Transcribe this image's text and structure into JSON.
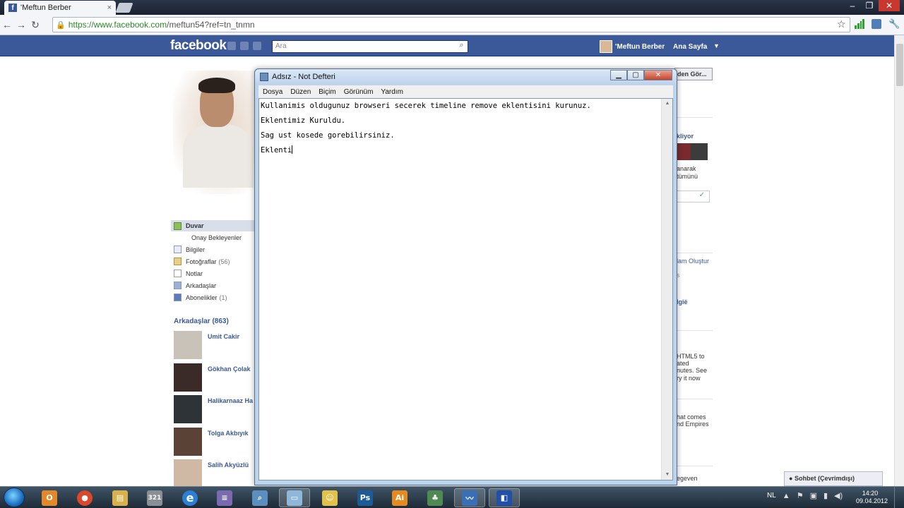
{
  "browser": {
    "tab_title": "'Meftun Berber",
    "tab_close": "×",
    "url_host": "https://www.facebook.com",
    "url_path": "/meftun54?ref=tn_tnmn",
    "back": "←",
    "forward": "→",
    "reload": "↻",
    "star": "☆",
    "wrench": "🔧",
    "window_min": "–",
    "window_max": "❐",
    "window_close": "✕"
  },
  "facebook": {
    "logo": "facebook",
    "search_placeholder": "Ara",
    "search_icon": "⌕",
    "user_name": "'Meftun Berber",
    "home": "Ana Sayfa",
    "caret": "▼",
    "nav": [
      {
        "label": "Duvar",
        "icon": "wall-icon"
      },
      {
        "label": "Onay Bekleyenler"
      },
      {
        "label": "Bilgiler",
        "icon": "info-icon"
      },
      {
        "label": "Fotoğraflar",
        "count": "(56)",
        "icon": "photos-icon"
      },
      {
        "label": "Notlar",
        "icon": "notes-icon"
      },
      {
        "label": "Arkadaşlar",
        "icon": "friends-icon"
      },
      {
        "label": "Abonelikler",
        "count": "(1)",
        "icon": "subscriptions-icon"
      }
    ],
    "friends_header": "Arkadaşlar (863)",
    "friends": [
      {
        "name": "Umit Cakir",
        "color": "#c9c2b8"
      },
      {
        "name": "Gökhan Çolak",
        "color": "#3a2a28"
      },
      {
        "name": "Halikarnaaz Ha",
        "color": "#2e3338"
      },
      {
        "name": "Tolga Akbıyık",
        "color": "#5a4336"
      },
      {
        "name": "Salih Akyüzlü",
        "color": "#cfb9a4"
      }
    ],
    "right_column": {
      "button": "den Gör...",
      "pending": "kliyor",
      "text1": "anarak",
      "text2": "tümünü",
      "check": "✓",
      "create": "lam Oluştur",
      "text3": "s",
      "link2": "lgië",
      "ad1": [
        "HTML5 to",
        "ated",
        "nutes. See",
        "ry it now"
      ],
      "ad2": [
        "hat comes",
        "nd Empires"
      ],
      "ad3": "egeven"
    },
    "chat": "Sohbet (Çevrimdışı)"
  },
  "notepad": {
    "title": "Adsız - Not Defteri",
    "btn_min": "▁",
    "btn_max": "▢",
    "btn_close": "✕",
    "menu": [
      "Dosya",
      "Düzen",
      "Biçim",
      "Görünüm",
      "Yardım"
    ],
    "lines": [
      "Kullanimis oldugunuz browseri secerek timeline remove eklentisini kurunuz.",
      "Eklentimiz Kuruldu.",
      "Sag ust kosede gorebilirsiniz.",
      "Eklenti"
    ],
    "scroll_up": "▲",
    "scroll_down": "▼"
  },
  "taskbar": {
    "apps": [
      {
        "name": "outlook",
        "label": "O",
        "color": "#e4882a"
      },
      {
        "name": "chrome",
        "label": "●",
        "color": "#d9482b"
      },
      {
        "name": "explorer",
        "label": "▤",
        "color": "#d8b14a"
      },
      {
        "name": "calendar",
        "label": "321",
        "color": "#8a8f96"
      },
      {
        "name": "internet-explorer",
        "label": "e",
        "color": "#2c7fd6"
      },
      {
        "name": "media",
        "label": "≡",
        "color": "#7a6bb0"
      },
      {
        "name": "search",
        "label": "⌕",
        "color": "#5a8fbf"
      },
      {
        "name": "notepad",
        "label": "▭",
        "color": "#8fb7d9"
      },
      {
        "name": "messenger",
        "label": "☺",
        "color": "#e2c24a"
      },
      {
        "name": "photoshop",
        "label": "Ps",
        "color": "#1c5a9a"
      },
      {
        "name": "illustrator",
        "label": "Ai",
        "color": "#e58a1e"
      },
      {
        "name": "people",
        "label": "♣",
        "color": "#4f8a52"
      },
      {
        "name": "stats",
        "label": "〰",
        "color": "#3a6fb5"
      },
      {
        "name": "remote",
        "label": "◧",
        "color": "#2050a8"
      }
    ],
    "lang": "NL",
    "tray_icons": [
      "▲",
      "⚑",
      "▣",
      "▮",
      "◀)"
    ],
    "time": "14:20",
    "date": "09.04.2012"
  }
}
